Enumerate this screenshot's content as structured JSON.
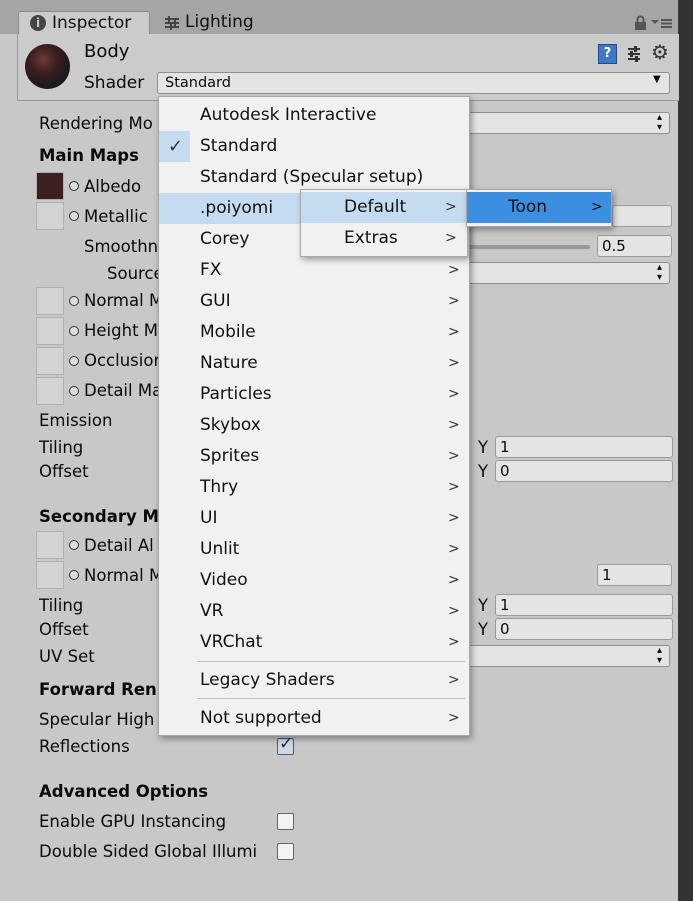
{
  "tabs": {
    "inspector": "Inspector",
    "lighting": "Lighting"
  },
  "material": {
    "name": "Body",
    "shader_label": "Shader",
    "shader_value": "Standard"
  },
  "inspector": {
    "rendering_mode": "Rendering Mo",
    "main_maps": "Main Maps",
    "albedo": "Albedo",
    "metallic": "Metallic",
    "smoothness": "Smoothn",
    "smoothness_value": "0.5",
    "source": "Source",
    "normal_map": "Normal M",
    "height_map": "Height M",
    "occlusion": "Occlusion",
    "detail_mask": "Detail Ma",
    "emission": "Emission",
    "tiling": "Tiling",
    "offset": "Offset",
    "y_label": "Y",
    "tiling_y": "1",
    "offset_y": "0",
    "secondary_maps": "Secondary M",
    "detail_albedo": "Detail Al",
    "normal_map2": "Normal M",
    "normal_scale": "1",
    "tiling2": "Tiling",
    "offset2": "Offset",
    "tiling2_y": "1",
    "offset2_y": "0",
    "uv_set": "UV Set",
    "forward_rendering": "Forward Ren",
    "specular_highlights": "Specular High",
    "reflections": "Reflections",
    "advanced_options": "Advanced Options",
    "gpu_instancing": "Enable GPU Instancing",
    "double_sided_gi": "Double Sided Global Illumi"
  },
  "shader_menu": {
    "items": [
      {
        "label": "Autodesk Interactive"
      },
      {
        "label": "Standard",
        "checked_glyph": "✓"
      },
      {
        "label": "Standard (Specular setup)"
      },
      {
        "label": ".poiyomi"
      },
      {
        "label": "Corey"
      },
      {
        "label": "FX"
      },
      {
        "label": "GUI"
      },
      {
        "label": "Mobile"
      },
      {
        "label": "Nature"
      },
      {
        "label": "Particles"
      },
      {
        "label": "Skybox"
      },
      {
        "label": "Sprites"
      },
      {
        "label": "Thry"
      },
      {
        "label": "UI"
      },
      {
        "label": "Unlit"
      },
      {
        "label": "Video"
      },
      {
        "label": "VR"
      },
      {
        "label": "VRChat"
      },
      {
        "label": "Legacy Shaders"
      },
      {
        "label": "Not supported"
      }
    ]
  },
  "poiyomi_submenu": {
    "items": [
      {
        "label": "Default"
      },
      {
        "label": "Extras"
      }
    ]
  },
  "default_submenu": {
    "items": [
      {
        "label": "Toon"
      }
    ]
  },
  "colors": {
    "highlight": "#c5dcf0",
    "selected": "#3b8ee0",
    "menu_bg": "#f1f1f1"
  }
}
